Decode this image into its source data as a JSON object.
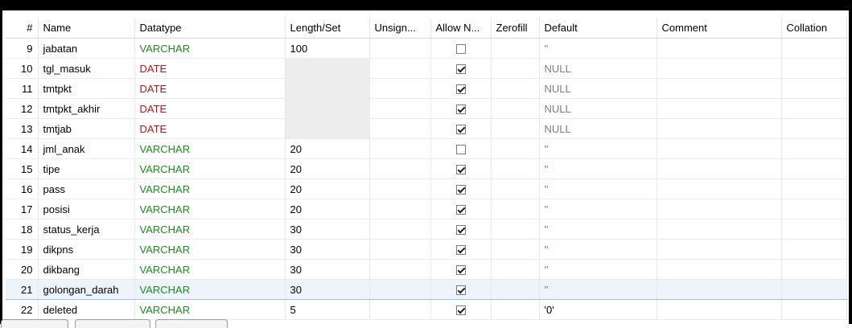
{
  "columns": [
    "#",
    "Name",
    "Datatype",
    "Length/Set",
    "Unsign...",
    "Allow N...",
    "Zerofill",
    "Default",
    "Comment",
    "Collation"
  ],
  "rows": [
    {
      "num": "9",
      "name": "jabatan",
      "type": "VARCHAR",
      "length": "100",
      "allow_null": false,
      "default": "''",
      "selected": false
    },
    {
      "num": "10",
      "name": "tgl_masuk",
      "type": "DATE",
      "length": "",
      "allow_null": true,
      "default": "NULL",
      "selected": false
    },
    {
      "num": "11",
      "name": "tmtpkt",
      "type": "DATE",
      "length": "",
      "allow_null": true,
      "default": "NULL",
      "selected": false
    },
    {
      "num": "12",
      "name": "tmtpkt_akhir",
      "type": "DATE",
      "length": "",
      "allow_null": true,
      "default": "NULL",
      "selected": false
    },
    {
      "num": "13",
      "name": "tmtjab",
      "type": "DATE",
      "length": "",
      "allow_null": true,
      "default": "NULL",
      "selected": false
    },
    {
      "num": "14",
      "name": "jml_anak",
      "type": "VARCHAR",
      "length": "20",
      "allow_null": false,
      "default": "''",
      "selected": false
    },
    {
      "num": "15",
      "name": "tipe",
      "type": "VARCHAR",
      "length": "20",
      "allow_null": true,
      "default": "''",
      "selected": false
    },
    {
      "num": "16",
      "name": "pass",
      "type": "VARCHAR",
      "length": "20",
      "allow_null": true,
      "default": "''",
      "selected": false
    },
    {
      "num": "17",
      "name": "posisi",
      "type": "VARCHAR",
      "length": "20",
      "allow_null": true,
      "default": "''",
      "selected": false
    },
    {
      "num": "18",
      "name": "status_kerja",
      "type": "VARCHAR",
      "length": "30",
      "allow_null": true,
      "default": "''",
      "selected": false
    },
    {
      "num": "19",
      "name": "dikpns",
      "type": "VARCHAR",
      "length": "30",
      "allow_null": true,
      "default": "''",
      "selected": false
    },
    {
      "num": "20",
      "name": "dikbang",
      "type": "VARCHAR",
      "length": "30",
      "allow_null": true,
      "default": "''",
      "selected": false
    },
    {
      "num": "21",
      "name": "golongan_darah",
      "type": "VARCHAR",
      "length": "30",
      "allow_null": true,
      "default": "''",
      "selected": true
    },
    {
      "num": "22",
      "name": "deleted",
      "type": "VARCHAR",
      "length": "5",
      "allow_null": true,
      "default": "'0'",
      "selected": false
    }
  ],
  "colors": {
    "varchar": "#1a8c1a",
    "date": "#b01818",
    "selected_row": "#eef4fc",
    "window_frame": "#000000"
  }
}
